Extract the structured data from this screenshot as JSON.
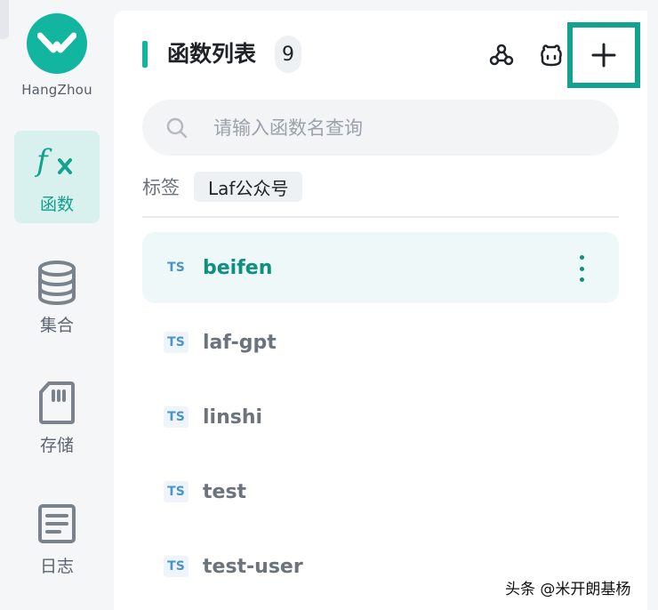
{
  "sidebar": {
    "region": "HangZhou",
    "items": [
      {
        "label": "函数",
        "icon": "function-icon",
        "active": true
      },
      {
        "label": "集合",
        "icon": "database-icon",
        "active": false
      },
      {
        "label": "存储",
        "icon": "storage-card-icon",
        "active": false
      },
      {
        "label": "日志",
        "icon": "log-icon",
        "active": false
      }
    ]
  },
  "header": {
    "title": "函数列表",
    "count": "9",
    "icons": [
      "webhook-icon",
      "robot-icon",
      "plus-icon"
    ]
  },
  "search": {
    "placeholder": "请输入函数名查询",
    "value": ""
  },
  "tags": {
    "label": "标签",
    "chips": [
      "Laf公众号"
    ]
  },
  "functions": [
    {
      "badge": "TS",
      "name": "beifen",
      "active": true
    },
    {
      "badge": "TS",
      "name": "laf-gpt",
      "active": false
    },
    {
      "badge": "TS",
      "name": "linshi",
      "active": false
    },
    {
      "badge": "TS",
      "name": "test",
      "active": false
    },
    {
      "badge": "TS",
      "name": "test-user",
      "active": false
    }
  ],
  "watermark": "头条 @米开朗基杨",
  "colors": {
    "accent": "#12b5a0",
    "accent_dark": "#0e8f80",
    "active_bg": "#eef8f8",
    "highlight_border": "#12a28f"
  }
}
